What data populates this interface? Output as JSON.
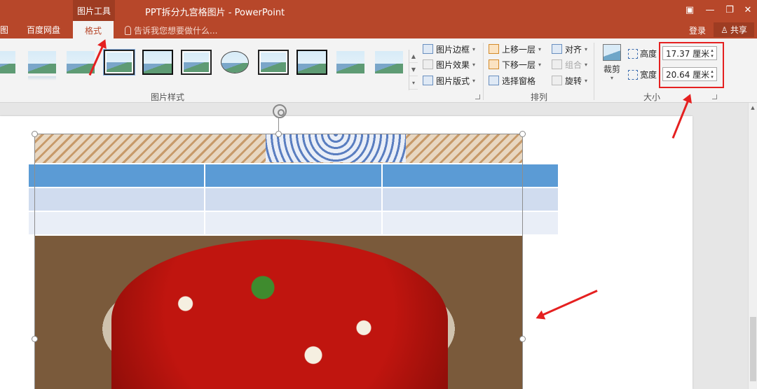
{
  "window": {
    "context_tab_group": "图片工具",
    "title": "PPT拆分九宫格图片 - PowerPoint"
  },
  "tabs": {
    "partial_left": "图",
    "baidu": "百度网盘",
    "format": "格式"
  },
  "tell_me": "告诉我您想要做什么...",
  "account": {
    "login": "登录",
    "share": "共享"
  },
  "picture_styles": {
    "border": "图片边框",
    "effects": "图片效果",
    "layout": "图片版式",
    "group_label": "图片样式"
  },
  "arrange": {
    "bring_forward": "上移一层",
    "send_backward": "下移一层",
    "selection_pane": "选择窗格",
    "align": "对齐",
    "group": "组合",
    "rotate": "旋转",
    "group_label": "排列"
  },
  "size": {
    "crop": "裁剪",
    "height_label": "高度",
    "height_value": "17.37 厘米",
    "width_label": "宽度",
    "width_value": "20.64 厘米",
    "group_label": "大小"
  },
  "icons": {
    "gallery_up": "▲",
    "gallery_down": "▼",
    "gallery_more": "▾",
    "dropdown": "▾",
    "spin_up": "▴",
    "spin_down": "▾",
    "scroll_up": "▲",
    "ribbon_display": "▣",
    "minimize": "—",
    "restore": "❐",
    "close": "✕",
    "person": "♙"
  },
  "colors": {
    "accent": "#b7472a",
    "highlight": "#e52020",
    "table_header": "#5b9bd5"
  }
}
